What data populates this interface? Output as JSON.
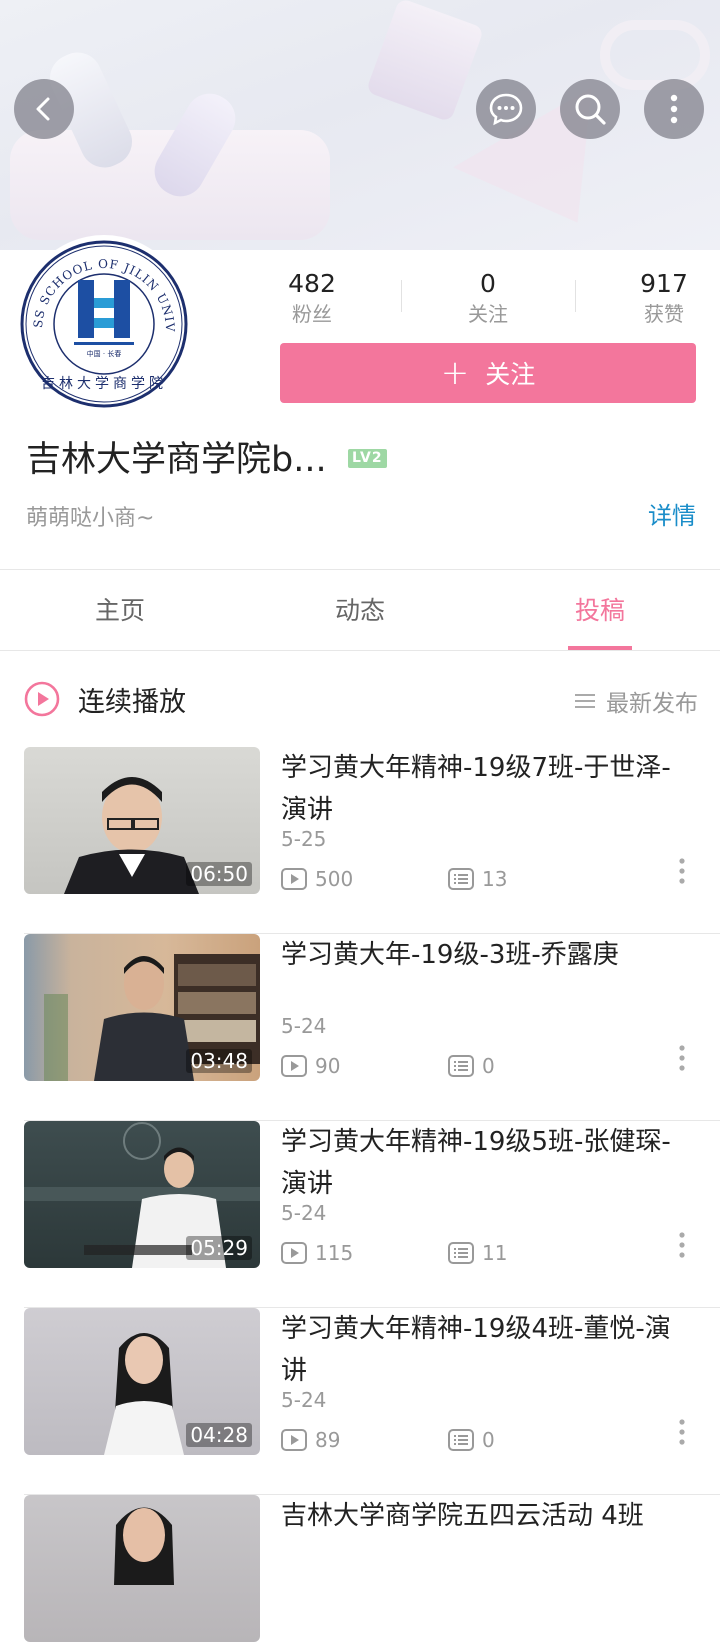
{
  "profile": {
    "name": "吉林大学商学院b...",
    "level_badge": "LV2",
    "signature": "萌萌哒小商~",
    "detail_link": "详情",
    "follow_button": "关注",
    "stats": [
      {
        "value": "482",
        "label": "粉丝"
      },
      {
        "value": "0",
        "label": "关注"
      },
      {
        "value": "917",
        "label": "获赞"
      }
    ]
  },
  "avatar_logo": {
    "ring_text": "BUSINESS SCHOOL OF JILIN UNIVERSITY",
    "cn_text": "吉林大学商学院",
    "sub_text": "中国 · 长春"
  },
  "tabs": [
    {
      "label": "主页"
    },
    {
      "label": "动态"
    },
    {
      "label": "投稿"
    }
  ],
  "active_tab": "投稿",
  "playbar": {
    "label": "连续播放",
    "sort_label": "最新发布"
  },
  "videos": [
    {
      "title": "学习黄大年精神-19级7班-于世泽-演讲",
      "date": "5-25",
      "duration": "06:50",
      "plays": "500",
      "comments": "13"
    },
    {
      "title": "学习黄大年-19级-3班-乔露庚",
      "date": "5-24",
      "duration": "03:48",
      "plays": "90",
      "comments": "0"
    },
    {
      "title": "学习黄大年精神-19级5班-张健琛-演讲",
      "date": "5-24",
      "duration": "05:29",
      "plays": "115",
      "comments": "11"
    },
    {
      "title": "学习黄大年精神-19级4班-董悦-演讲",
      "date": "5-24",
      "duration": "04:28",
      "plays": "89",
      "comments": "0"
    },
    {
      "title": "吉林大学商学院五四云活动 4班",
      "date": "",
      "duration": "",
      "plays": "",
      "comments": ""
    }
  ],
  "colors": {
    "accent": "#f3769c",
    "link": "#1a8dc9",
    "level_badge": "#9ed8a4"
  },
  "icons": [
    "back-icon",
    "chat-icon",
    "search-icon",
    "more-vertical-icon",
    "play-circle-icon",
    "sort-menu-icon",
    "video-play-count-icon",
    "comment-count-icon"
  ]
}
